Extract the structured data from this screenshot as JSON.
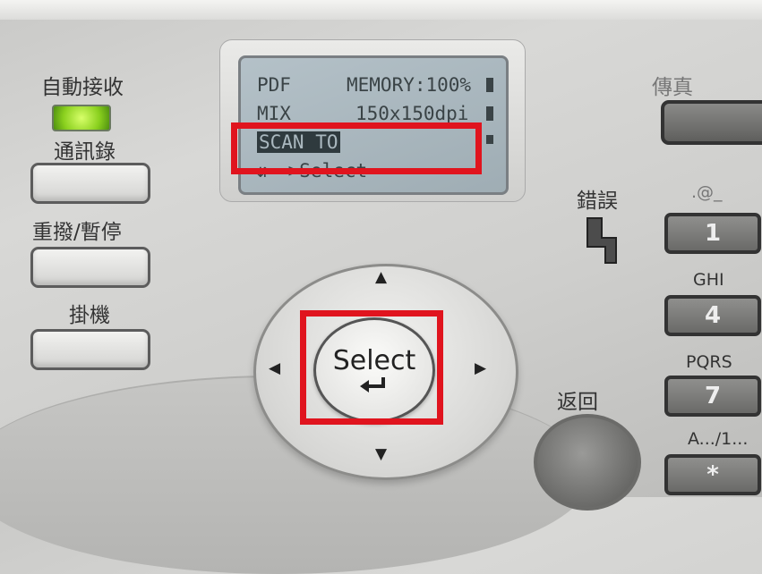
{
  "left_panel": {
    "auto_receive_label": "自動接收",
    "address_book_label": "通訊錄",
    "redial_pause_label": "重撥/暫停",
    "hang_up_label": "掛機"
  },
  "lcd": {
    "line1_left": "PDF",
    "line1_right": "MEMORY:100%",
    "line2_left": "MIX",
    "line2_right": "150x150dpi",
    "line3": "SCAN TO",
    "line4": "->Select"
  },
  "nav": {
    "select_label": "Select",
    "up_arrow": "▲",
    "down_arrow": "▼",
    "left_arrow": "◀",
    "right_arrow": "▶"
  },
  "right_panel": {
    "fax_label": "傳真",
    "error_label": "錯誤",
    "back_label": "返回",
    "keys": [
      {
        "top_label": ".@_",
        "key": "1"
      },
      {
        "top_label": "GHI",
        "key": "4"
      },
      {
        "top_label": "PQRS",
        "key": "7"
      },
      {
        "top_label": "A.../1...",
        "key": "*"
      }
    ]
  },
  "colors": {
    "highlight": "#e0141e",
    "led": "#8ad01e"
  }
}
